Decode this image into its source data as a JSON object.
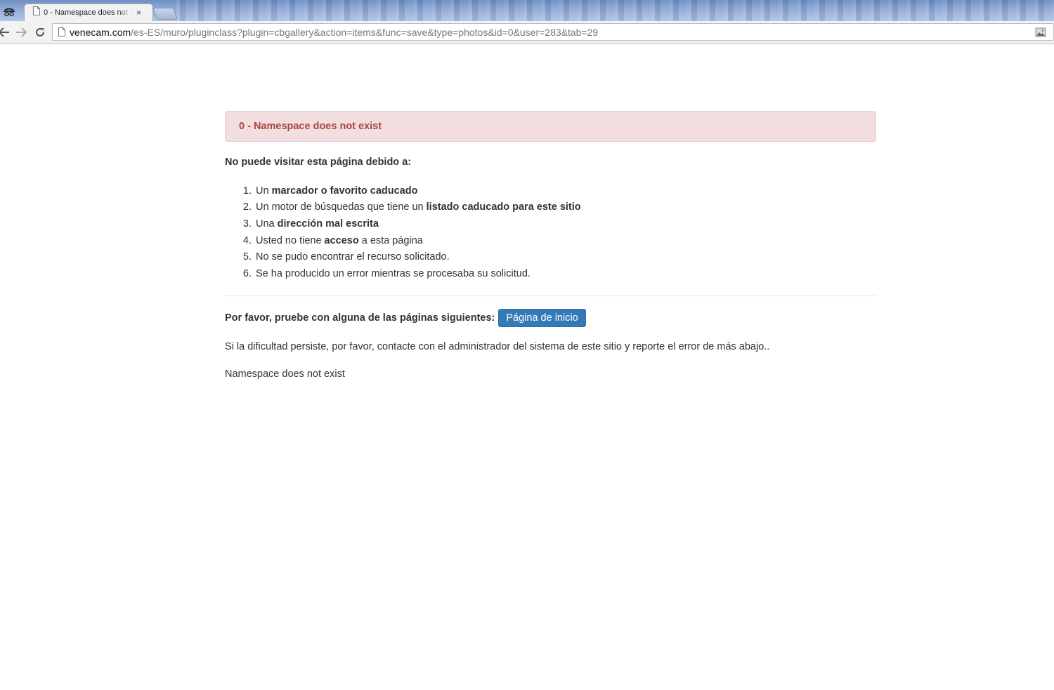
{
  "browser": {
    "tab_title": "0 - Namespace does not exist",
    "tab_close": "×",
    "url_host": "venecam.com",
    "url_path": "/es-ES/muro/pluginclass?plugin=cbgallery&action=items&func=save&type=photos&id=0&user=283&tab=29"
  },
  "page": {
    "alert_text": "0 - Namespace does not exist",
    "reason_title": "No puede visitar esta página debido a:",
    "reasons": [
      {
        "num": "1.",
        "pre": "Un ",
        "bold": "marcador o favorito caducado",
        "post": ""
      },
      {
        "num": "2.",
        "pre": "Un motor de búsquedas que tiene un ",
        "bold": "listado caducado para este sitio",
        "post": ""
      },
      {
        "num": "3.",
        "pre": "Una ",
        "bold": "dirección mal escrita",
        "post": ""
      },
      {
        "num": "4.",
        "pre": "Usted no tiene ",
        "bold": "acceso",
        "post": " a esta página"
      },
      {
        "num": "5.",
        "pre": "No se pudo encontrar el recurso solicitado.",
        "bold": "",
        "post": ""
      },
      {
        "num": "6.",
        "pre": "Se ha producido un error mientras se procesaba su solicitud.",
        "bold": "",
        "post": ""
      }
    ],
    "try_label": "Por favor, pruebe con alguna de las páginas siguientes:",
    "home_button": "Página de inicio",
    "persist_text": "Si la dificultad persiste, por favor, contacte con el administrador del sistema de este sitio y reporte el error de más abajo..",
    "error_message": "Namespace does not exist"
  },
  "icons": {
    "menu": "incognito-icon",
    "tab_page": "page-icon",
    "back": "back-arrow-icon",
    "forward": "forward-arrow-icon",
    "reload": "reload-icon",
    "url_page": "page-icon",
    "extension": "extension-icon"
  },
  "colors": {
    "alert_bg": "#f2dede",
    "alert_text": "#a94442",
    "button_bg": "#337ab7"
  }
}
